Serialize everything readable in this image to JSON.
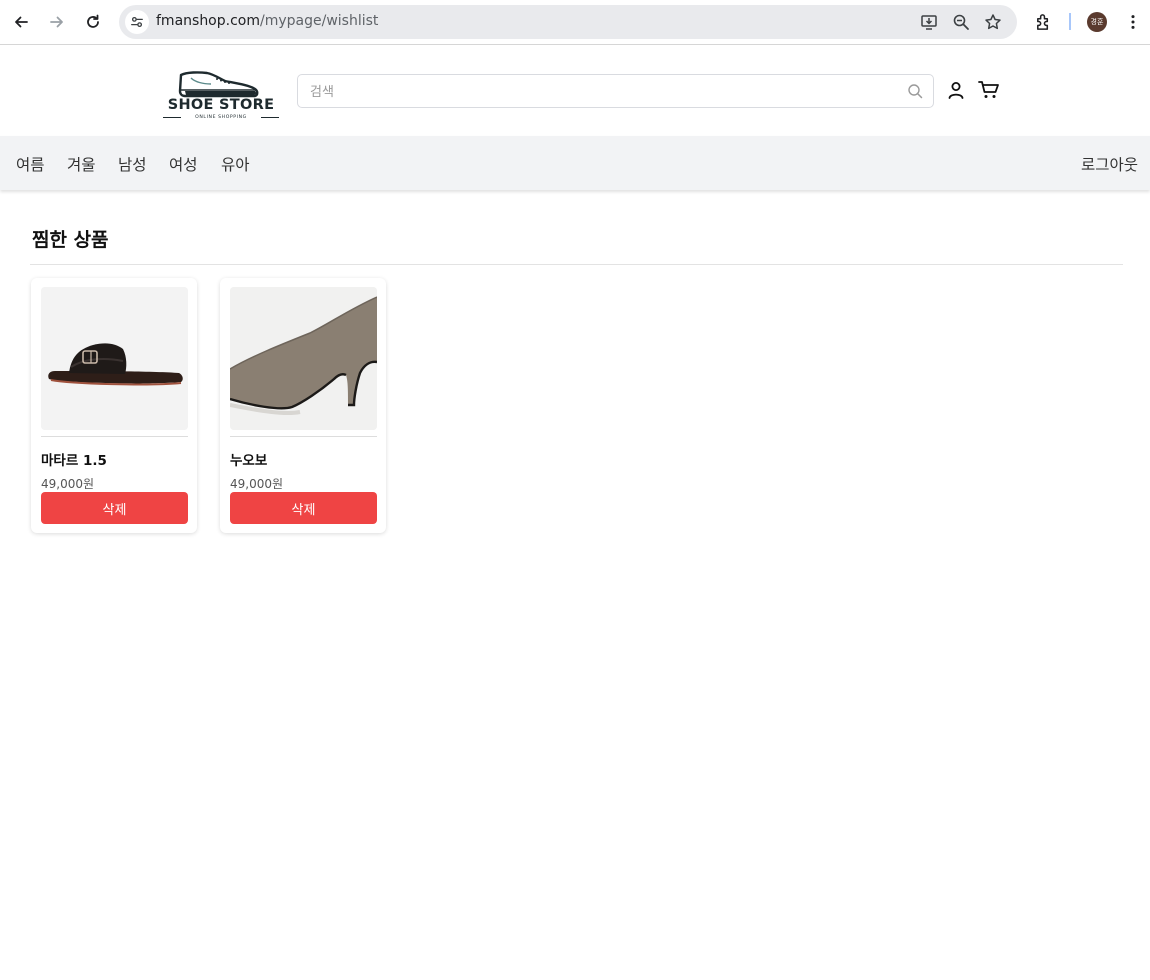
{
  "browser": {
    "url_domain": "fmanshop.com",
    "url_path": "/mypage/wishlist",
    "profile_initials": "경훈"
  },
  "header": {
    "logo_title": "SHOE STORE",
    "logo_subtitle": "ONLINE SHOPPING",
    "search_placeholder": "검색"
  },
  "nav": {
    "categories": [
      "여름",
      "겨울",
      "남성",
      "여성",
      "유아"
    ],
    "logout_label": "로그아웃"
  },
  "wishlist": {
    "title": "찜한 상품",
    "items": [
      {
        "name": "마타르 1.5",
        "price": "49,000원",
        "delete_label": "삭제"
      },
      {
        "name": "누오보",
        "price": "49,000원",
        "delete_label": "삭제"
      }
    ]
  },
  "colors": {
    "accent_delete": "#ef4444",
    "nav_background": "#f2f3f5"
  }
}
